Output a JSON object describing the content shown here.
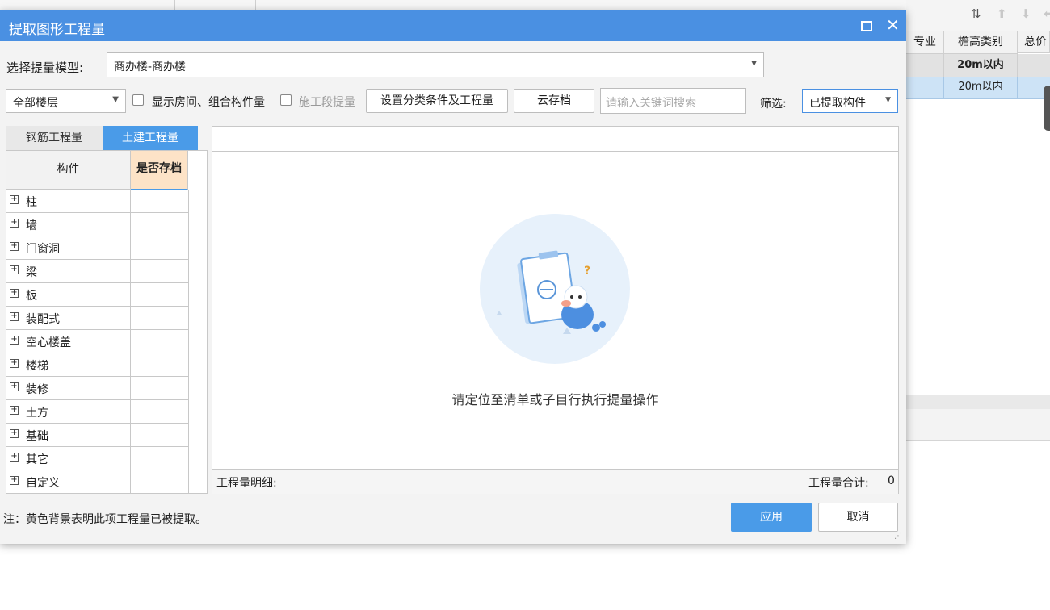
{
  "dialog": {
    "title": "提取图形工程量",
    "model_label": "选择提量模型:",
    "model_value": "商办楼-商办楼",
    "floor_value": "全部楼层",
    "show_room_label": "显示房间、组合构件量",
    "stage_label": "施工段提量",
    "set_button": "设置分类条件及工程量",
    "cloud_button": "云存档",
    "search_placeholder": "请输入关键词搜索",
    "filter_label": "筛选:",
    "filter_value": "已提取构件",
    "tabs": [
      {
        "label": "钢筋工程量",
        "active": false
      },
      {
        "label": "土建工程量",
        "active": true
      }
    ],
    "table_headers": {
      "component": "构件",
      "archived": "是否存档"
    },
    "components": [
      "柱",
      "墙",
      "门窗洞",
      "梁",
      "板",
      "装配式",
      "空心楼盖",
      "楼梯",
      "装修",
      "土方",
      "基础",
      "其它",
      "自定义"
    ],
    "empty_message": "请定位至清单或子目行执行提量操作",
    "detail_label": "工程量明细:",
    "total_label": "工程量合计:",
    "total_value": "0",
    "note": "注：黄色背景表明此项工程量已被提取。",
    "apply_button": "应用",
    "cancel_button": "取消"
  },
  "background": {
    "headers": [
      "专业",
      "檐高类别",
      "总价"
    ],
    "row1": "20m以内",
    "row2": "20m以内"
  },
  "colors": {
    "title_bar": "#4a90e2",
    "active_tab": "#4a9be8",
    "archived_header": "#fde3c7",
    "apply_button": "#4a9be8",
    "selected_row": "#cde3f6"
  }
}
